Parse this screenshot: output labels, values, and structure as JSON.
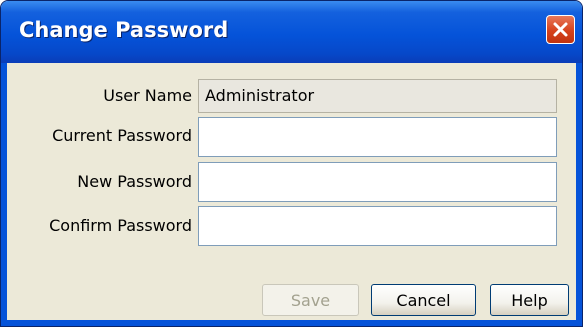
{
  "dialog": {
    "title": "Change Password",
    "close_icon": "close-icon"
  },
  "form": {
    "user_name_label": "User Name",
    "user_name_value": "Administrator",
    "current_password_label": "Current Password",
    "current_password_value": "",
    "new_password_label": "New Password",
    "new_password_value": "",
    "confirm_password_label": "Confirm Password",
    "confirm_password_value": ""
  },
  "buttons": {
    "save_label": "Save",
    "cancel_label": "Cancel",
    "help_label": "Help"
  },
  "colors": {
    "titlebar": "#0553d9",
    "close_button": "#d6421c",
    "dialog_background": "#ece9d8"
  }
}
